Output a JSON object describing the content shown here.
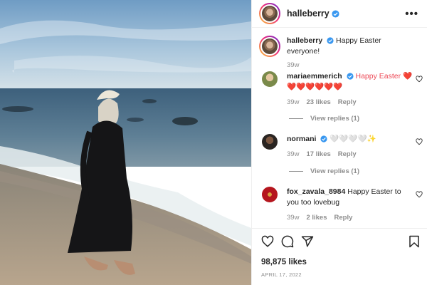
{
  "post": {
    "author": "halleberry",
    "caption": "Happy Easter everyone!",
    "caption_time": "39w",
    "likes": "98,875 likes",
    "date": "APRIL 17, 2022"
  },
  "comments": [
    {
      "username": "mariaemmerich",
      "verified": true,
      "text": "Happy Easter ❤️",
      "text_line2": "❤️❤️❤️❤️❤️❤️",
      "time": "39w",
      "likes": "23 likes",
      "reply": "Reply",
      "view_replies": "View replies (1)"
    },
    {
      "username": "normani",
      "verified": true,
      "text": "🤍🤍🤍🤍✨",
      "time": "39w",
      "likes": "17 likes",
      "reply": "Reply",
      "view_replies": "View replies (1)"
    },
    {
      "username": "fox_zavala_8984",
      "verified": false,
      "text": "Happy Easter to you too lovebug",
      "time": "39w",
      "likes": "2 likes",
      "reply": "Reply"
    }
  ],
  "icons": {
    "more": "more-options-icon",
    "like": "heart-icon",
    "comment": "comment-icon",
    "share": "share-icon",
    "save": "bookmark-icon",
    "verified": "verified-badge-icon"
  },
  "colors": {
    "verified": "#3897f0",
    "heart_red": "#ed4956",
    "meta_gray": "#8e8e8e"
  }
}
